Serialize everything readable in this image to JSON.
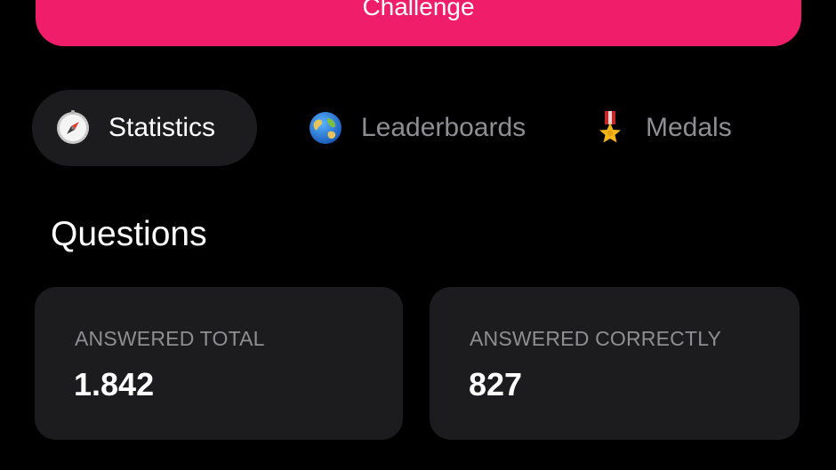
{
  "cta": {
    "label": "Challenge",
    "color": "#f01d6a"
  },
  "tabs": [
    {
      "label": "Statistics",
      "icon": "compass-icon",
      "active": true
    },
    {
      "label": "Leaderboards",
      "icon": "globe-icon",
      "active": false
    },
    {
      "label": "Medals",
      "icon": "medal-icon",
      "active": false
    }
  ],
  "questions": {
    "title": "Questions",
    "cards": [
      {
        "label": "ANSWERED TOTAL",
        "value": "1.842"
      },
      {
        "label": "ANSWERED CORRECTLY",
        "value": "827"
      }
    ]
  },
  "colors": {
    "background": "#000000",
    "card": "#1c1c1e",
    "muted_text": "#8e8e93",
    "accent": "#f01d6a"
  }
}
